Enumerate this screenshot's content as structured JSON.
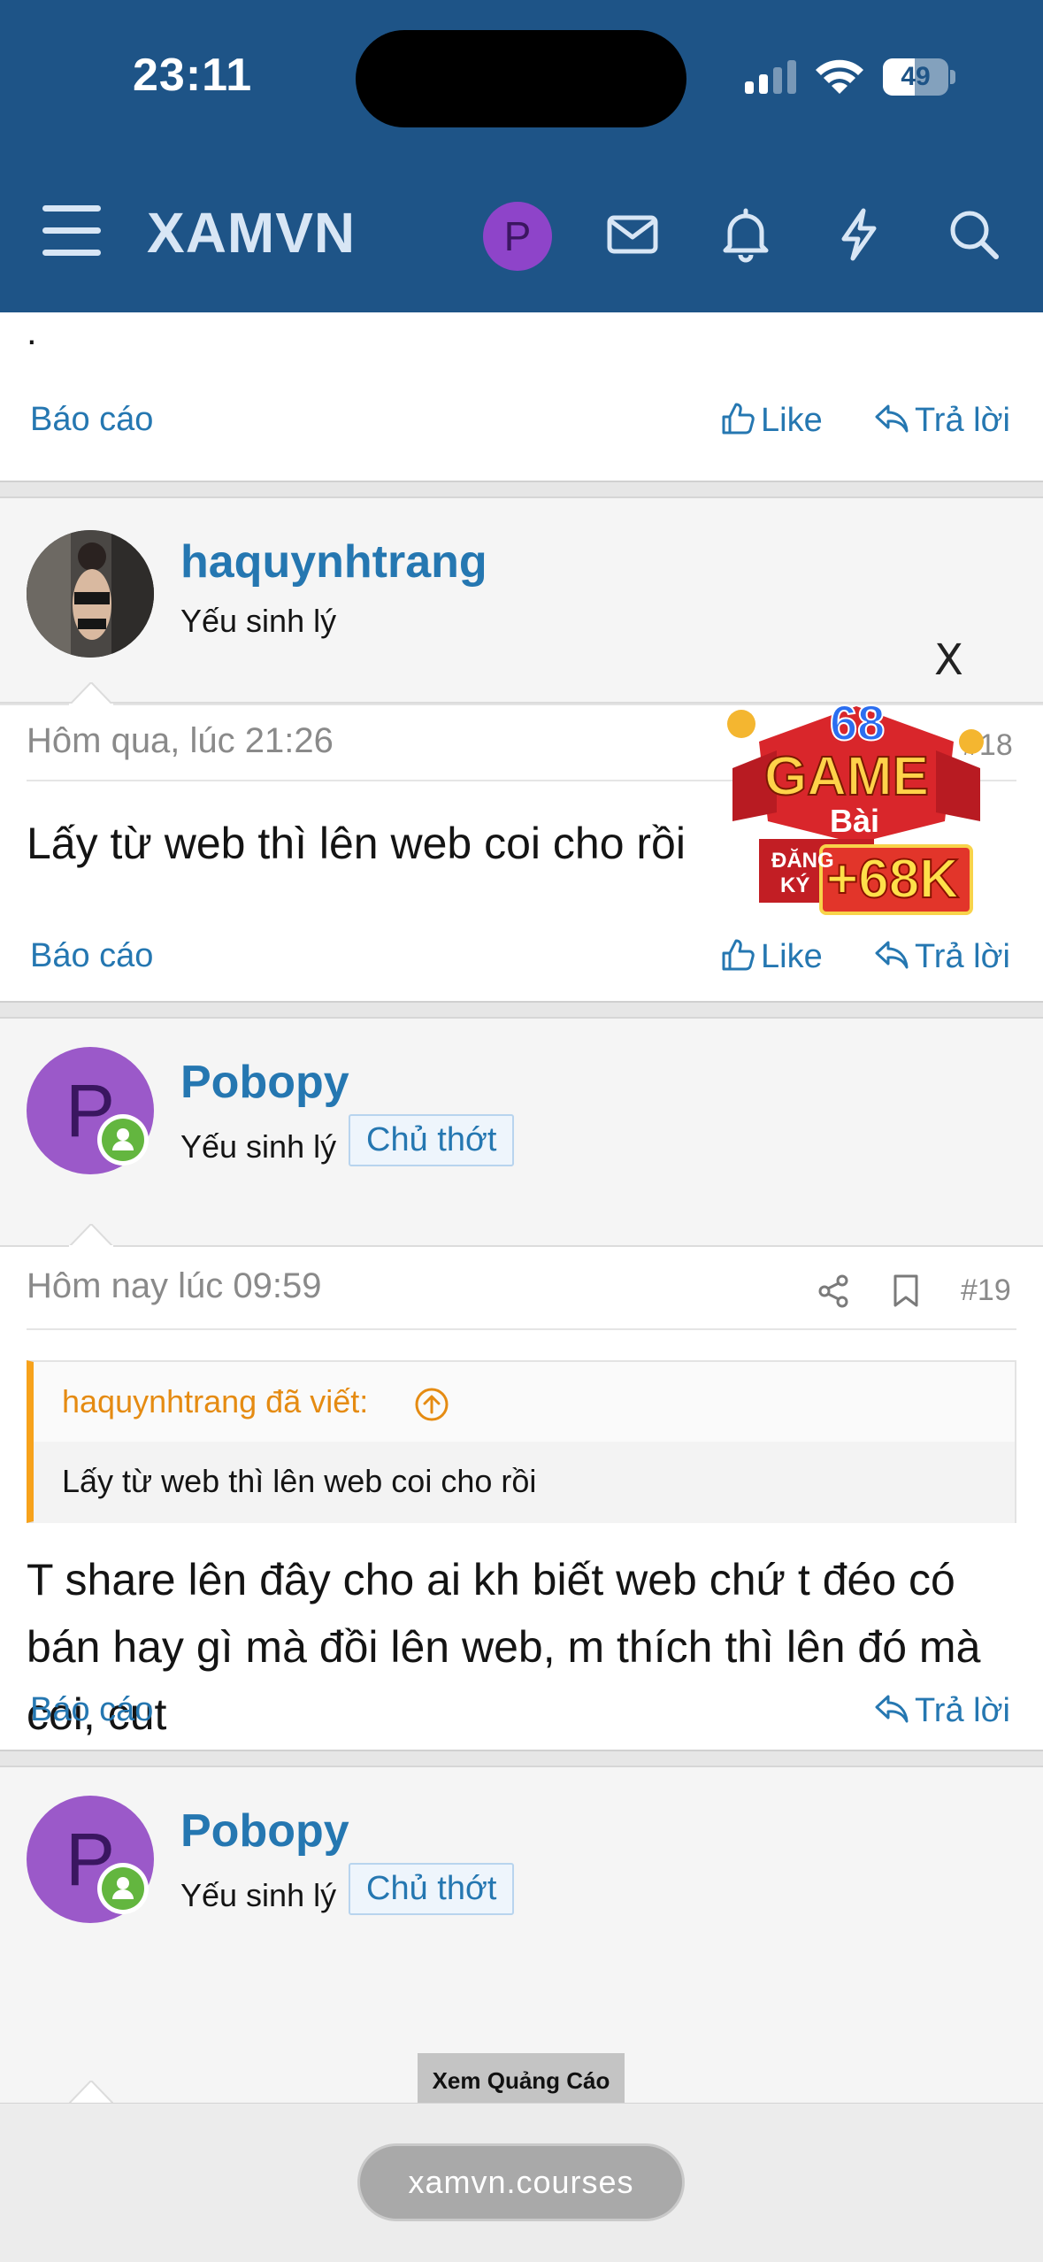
{
  "status": {
    "time": "23:11",
    "battery": "49",
    "battery_fraction": 0.49
  },
  "nav": {
    "logo": "XAMVN",
    "avatar_letter": "P",
    "icons": [
      "menu-icon",
      "mail-icon",
      "bell-icon",
      "bolt-icon",
      "search-icon"
    ]
  },
  "top_post": {
    "dot": ".",
    "report": "Báo cáo",
    "like": "Like",
    "reply": "Trả lời"
  },
  "post_18": {
    "username": "haquynhtrang",
    "usertitle": "Yếu sinh lý",
    "date": "Hôm qua, lúc 21:26",
    "number": "#18",
    "body": "Lấy từ web thì lên web coi cho rồi",
    "report": "Báo cáo",
    "like": "Like",
    "reply": "Trả lời"
  },
  "post_19": {
    "username": "Pobopy",
    "avatar_letter": "P",
    "usertitle": "Yếu sinh lý",
    "badge": "Chủ thớt",
    "date": "Hôm nay lúc 09:59",
    "number": "#19",
    "quote_author": "haquynhtrang đã viết:",
    "quote_text": "Lấy từ web thì lên web coi cho rồi",
    "body": "T share lên đây cho ai kh biết web chứ t đéo có bán hay gì mà đồi lên web, m thích thì lên đó mà coi, cut",
    "report": "Báo cáo",
    "reply": "Trả lời"
  },
  "post_20": {
    "username": "Pobopy",
    "avatar_letter": "P",
    "usertitle": "Yếu sinh lý",
    "badge": "Chủ thớt"
  },
  "ad": {
    "close": "X",
    "number_text": "68",
    "title": "GAME",
    "subtitle": "Bài",
    "register_line1": "ĐĂNG",
    "register_line2": "KÝ",
    "bonus": "+68K",
    "view_ad_label": "Xem Quảng Cáo"
  },
  "browser": {
    "url": "xamvn.courses"
  },
  "colors": {
    "header": "#1e5487",
    "link": "#2577b1",
    "quote_accent": "#f7a21b",
    "online": "#63b63f",
    "avatar_purple": "#9b59c9"
  }
}
